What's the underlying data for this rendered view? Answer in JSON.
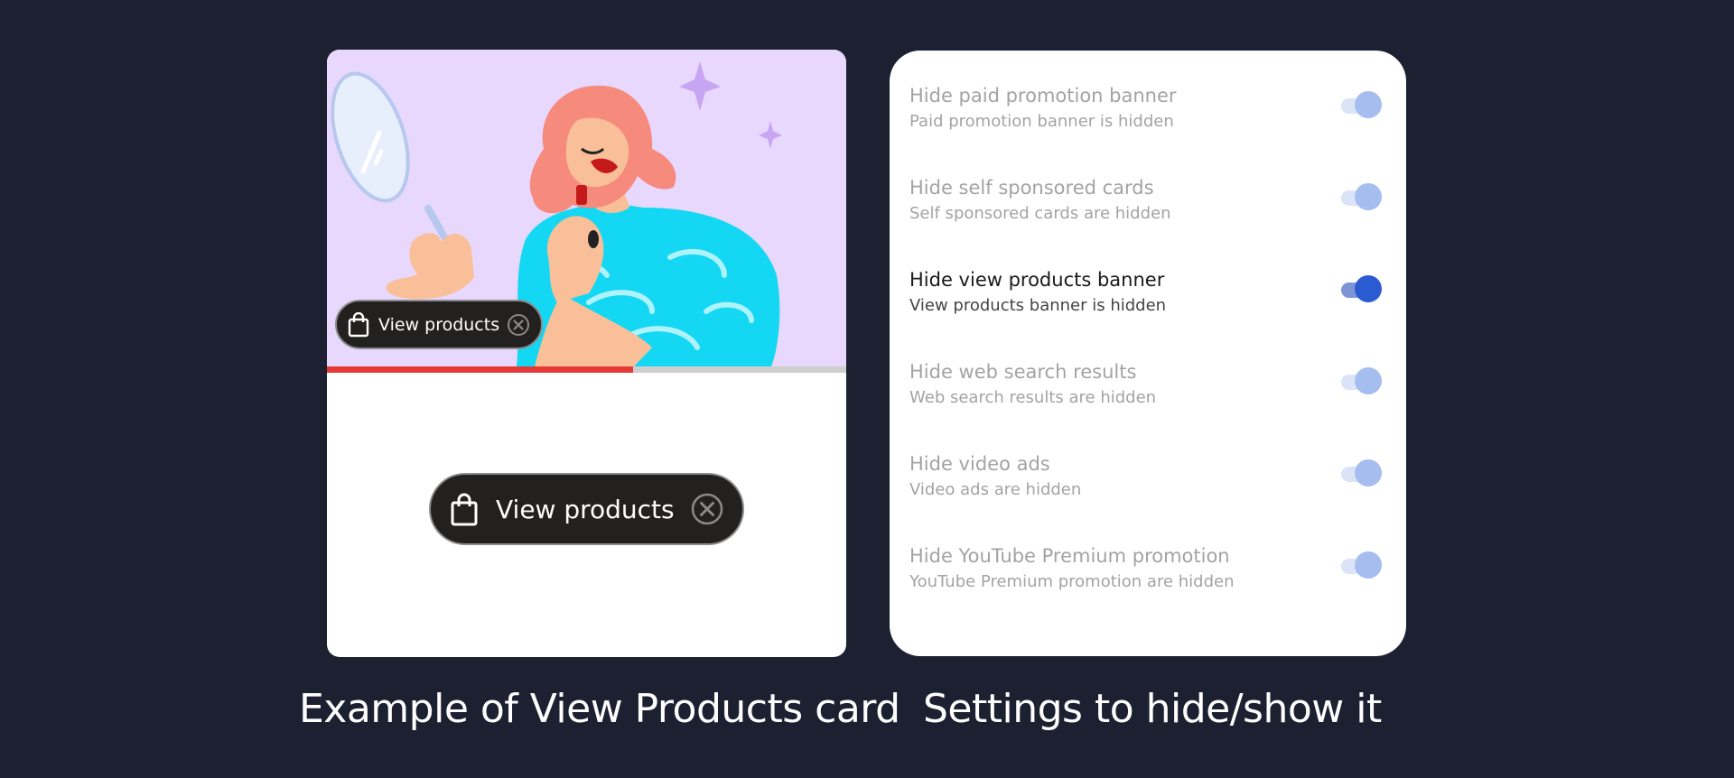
{
  "example": {
    "chip_small_label": "View products",
    "chip_large_label": "View products",
    "progress_fraction": 0.59,
    "icons": {
      "bag": "shopping-bag-icon",
      "close": "close-circle-icon"
    }
  },
  "settings": [
    {
      "title": "Hide paid promotion banner",
      "subtitle": "Paid promotion banner is hidden",
      "enabled": false,
      "on": true
    },
    {
      "title": "Hide self sponsored cards",
      "subtitle": "Self sponsored cards are hidden",
      "enabled": false,
      "on": true
    },
    {
      "title": "Hide view products banner",
      "subtitle": "View products banner is hidden",
      "enabled": true,
      "on": true
    },
    {
      "title": "Hide web search results",
      "subtitle": "Web search results are hidden",
      "enabled": false,
      "on": true
    },
    {
      "title": "Hide video ads",
      "subtitle": "Video ads are hidden",
      "enabled": false,
      "on": true
    },
    {
      "title": "Hide YouTube Premium promotion",
      "subtitle": "YouTube Premium promotion are hidden",
      "enabled": false,
      "on": true
    }
  ],
  "captions": {
    "left": "Example of View Products card",
    "right": "Settings to hide/show it"
  },
  "colors": {
    "background": "#1c2030",
    "progress": "#e53935",
    "toggle_active_thumb": "#2b5bd0",
    "toggle_active_track": "#7d95d6",
    "toggle_disabled_thumb": "#a6bdf0",
    "toggle_disabled_track": "#dbe4f7",
    "text_active_title": "#1a1a1a",
    "text_active_subtitle": "#444444",
    "text_disabled": "#a3a3a3"
  }
}
